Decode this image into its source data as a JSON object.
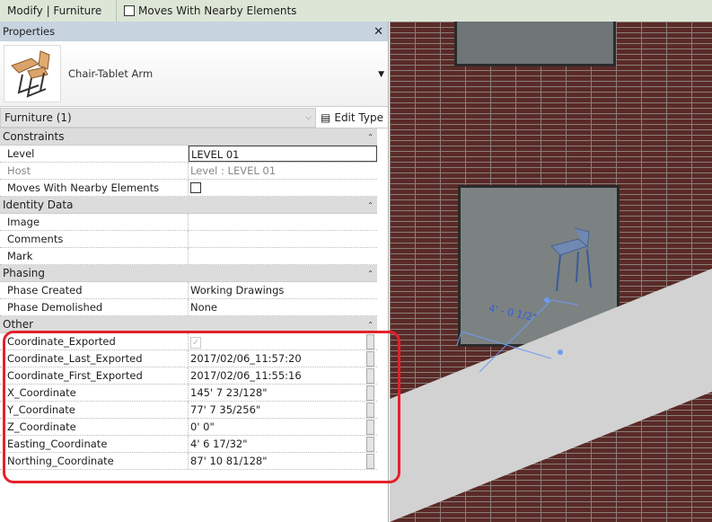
{
  "topbar": {
    "context": "Modify | Furniture",
    "option": "Moves With Nearby Elements"
  },
  "properties": {
    "title": "Properties",
    "close": "✕",
    "type_name": "Chair-Tablet Arm",
    "filter": "Furniture (1)",
    "edit_type": "Edit Type",
    "groups": [
      {
        "name": "Constraints",
        "rows": [
          {
            "k": "Level",
            "v": "LEVEL 01"
          },
          {
            "k": "Host",
            "v": "Level : LEVEL 01"
          },
          {
            "k": "Moves With Nearby Elements",
            "v": ""
          }
        ]
      },
      {
        "name": "Identity Data",
        "rows": [
          {
            "k": "Image",
            "v": ""
          },
          {
            "k": "Comments",
            "v": ""
          },
          {
            "k": "Mark",
            "v": ""
          }
        ]
      },
      {
        "name": "Phasing",
        "rows": [
          {
            "k": "Phase Created",
            "v": "Working Drawings"
          },
          {
            "k": "Phase Demolished",
            "v": "None"
          }
        ]
      },
      {
        "name": "Other",
        "rows": [
          {
            "k": "Coordinate_Exported",
            "v": "✓"
          },
          {
            "k": "Coordinate_Last_Exported",
            "v": "2017/02/06_11:57:20"
          },
          {
            "k": "Coordinate_First_Exported",
            "v": "2017/02/06_11:55:16"
          },
          {
            "k": "X_Coordinate",
            "v": "145'  7 23/128\""
          },
          {
            "k": "Y_Coordinate",
            "v": "77'  7 35/256\""
          },
          {
            "k": "Z_Coordinate",
            "v": "0'  0\""
          },
          {
            "k": "Easting_Coordinate",
            "v": "4'  6 17/32\""
          },
          {
            "k": "Northing_Coordinate",
            "v": "87'  10 81/128\""
          }
        ]
      }
    ]
  },
  "viewport": {
    "dimension": "4' - 0 1/2\""
  },
  "colors": {
    "highlight": "#e5202a",
    "dimension": "#3a6fe0"
  }
}
